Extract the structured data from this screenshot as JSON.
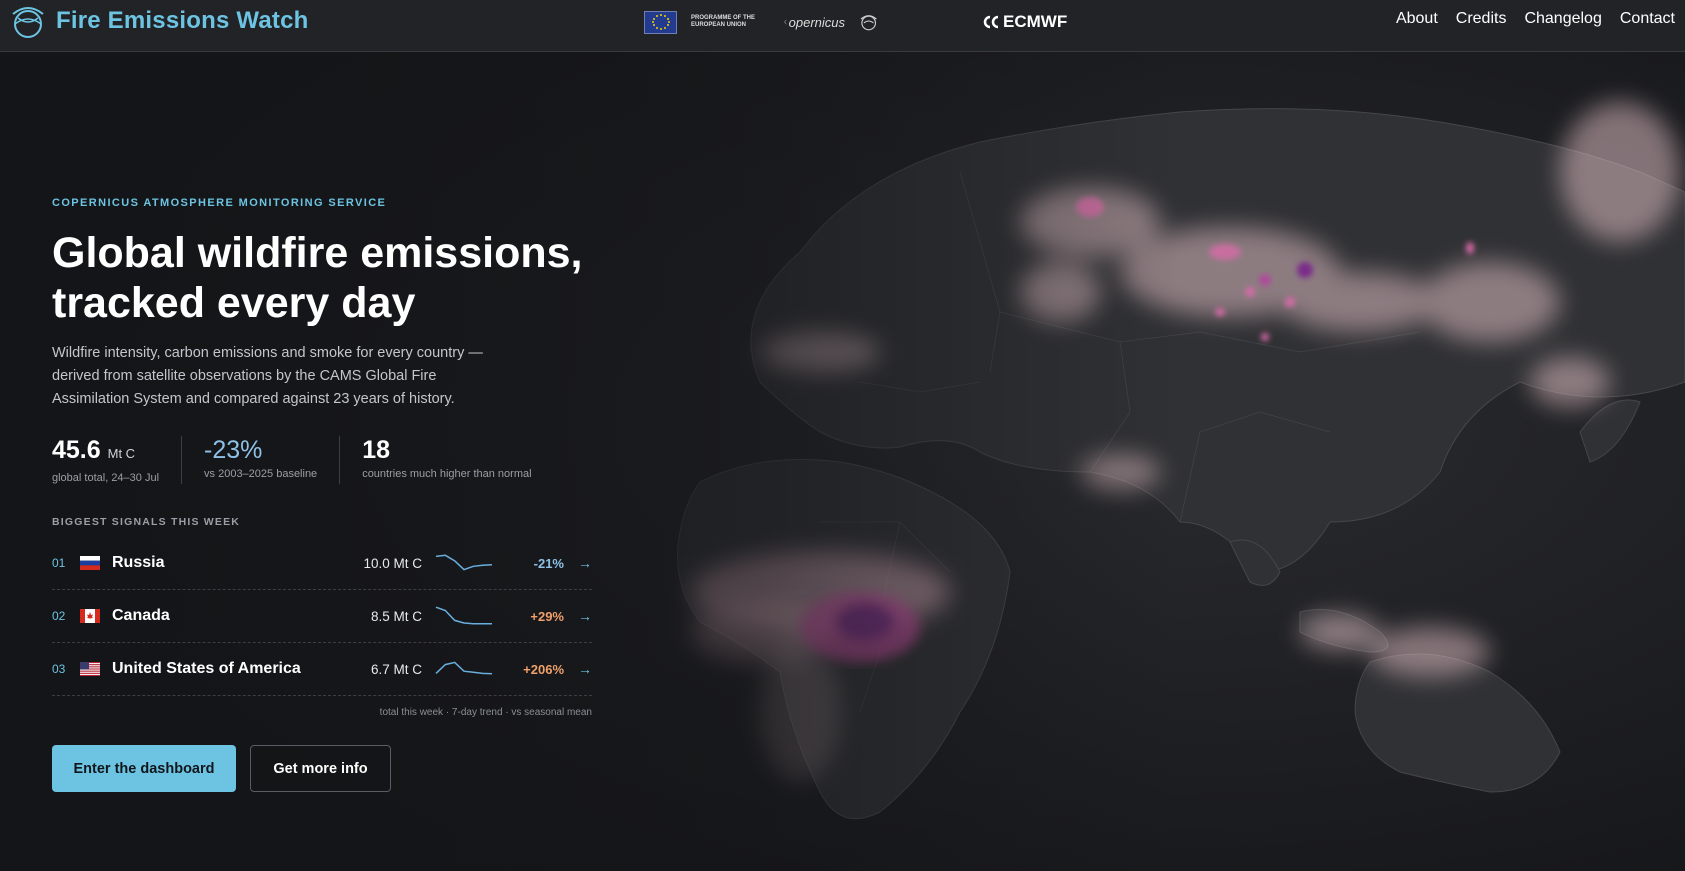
{
  "header": {
    "title": "Fire Emissions Watch",
    "partners": {
      "eu_label": "PROGRAMME OF THE EUROPEAN UNION",
      "copernicus_label": "opernicus",
      "ecmwf_label": "ECMWF"
    },
    "nav": [
      "About",
      "Credits",
      "Changelog",
      "Contact"
    ]
  },
  "hero": {
    "eyebrow": "COPERNICUS ATMOSPHERE MONITORING SERVICE",
    "headline": "Global wildfire emissions, tracked every day",
    "description": "Wildfire intensity, carbon emissions and smoke for every country — derived from satellite observations by the CAMS Global Fire Assimilation System and compared against 23 years of history."
  },
  "stats": [
    {
      "value": "45.6",
      "unit": "Mt C",
      "label": "global total, 24–30 Jul"
    },
    {
      "value": "-23%",
      "unit": "",
      "label": "vs 2003–2025 baseline"
    },
    {
      "value": "18",
      "unit": "",
      "label": "countries much higher than normal"
    }
  ],
  "signals": {
    "title": "BIGGEST SIGNALS THIS WEEK",
    "rows": [
      {
        "rank": "01",
        "country": "Russia",
        "value": "10.0 Mt C",
        "change": "-21%",
        "trend": [
          0.8,
          0.85,
          0.6,
          0.2,
          0.35,
          0.4,
          0.42
        ]
      },
      {
        "rank": "02",
        "country": "Canada",
        "value": "8.5 Mt C",
        "change": "+29%",
        "trend": [
          0.9,
          0.75,
          0.3,
          0.18,
          0.15,
          0.15,
          0.15
        ]
      },
      {
        "rank": "03",
        "country": "United States of America",
        "value": "6.7 Mt C",
        "change": "+206%",
        "trend": [
          0.3,
          0.7,
          0.8,
          0.4,
          0.35,
          0.3,
          0.28
        ]
      }
    ],
    "note": "total this week · 7-day trend · vs seasonal mean"
  },
  "actions": {
    "primary": "Enter the dashboard",
    "secondary": "Get more info"
  },
  "colors": {
    "accent": "#6cc4e2",
    "negative": "#8fc1e6",
    "positive": "#f0a06a"
  }
}
